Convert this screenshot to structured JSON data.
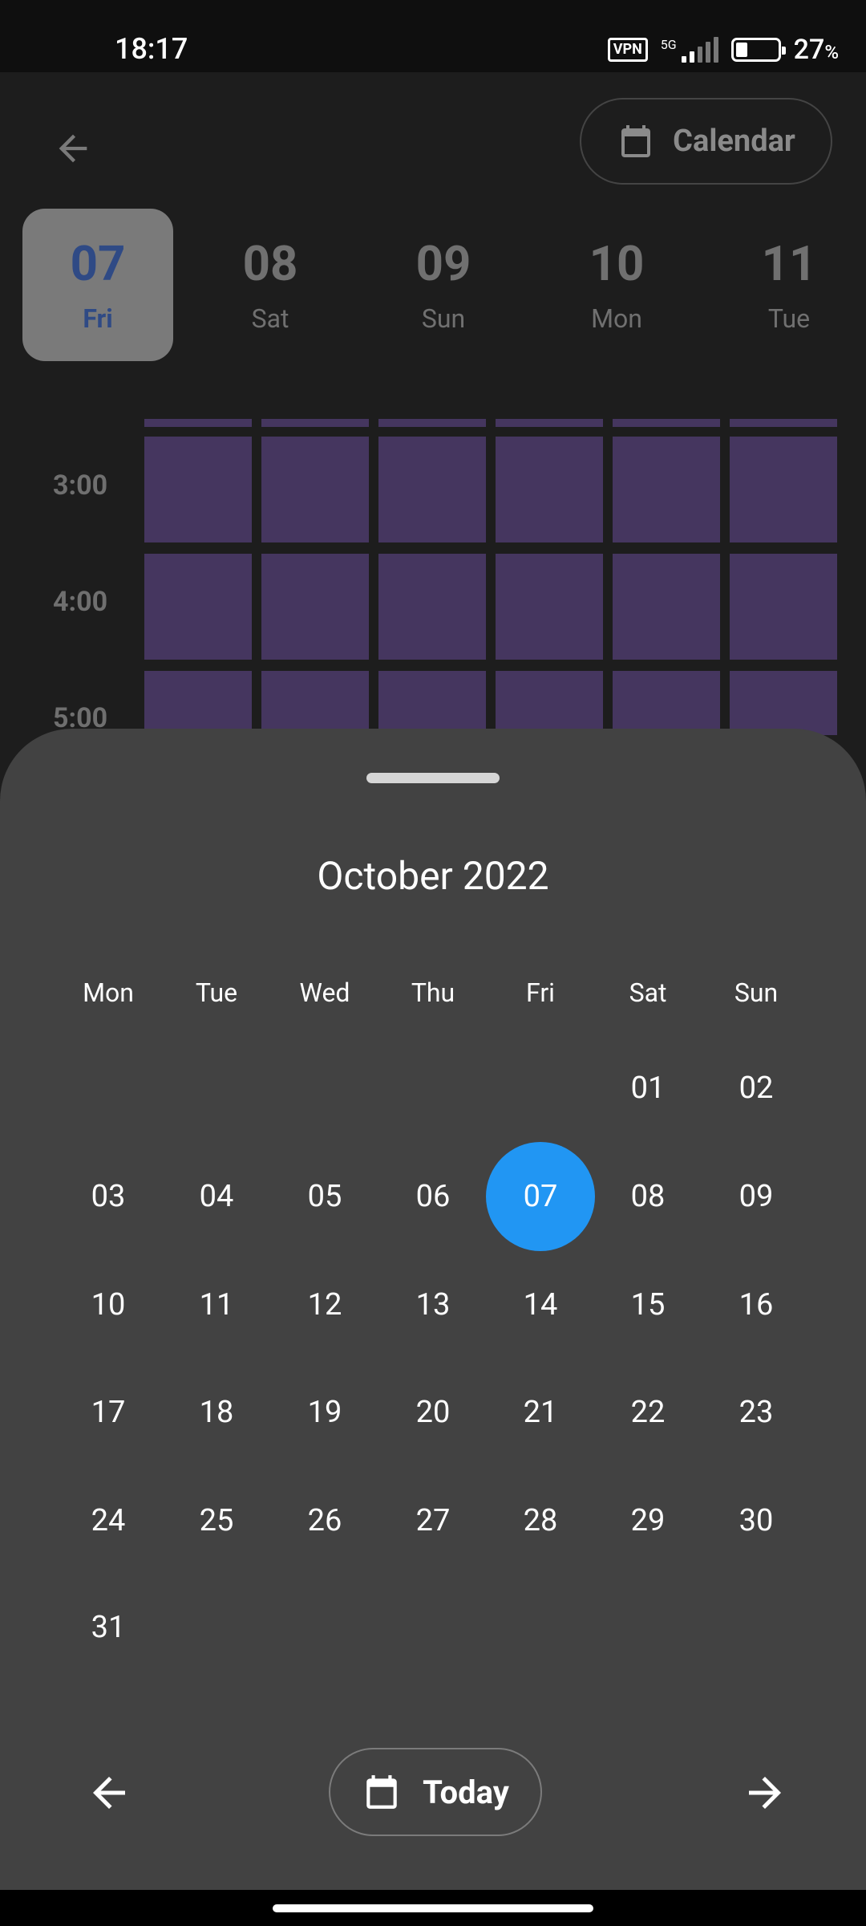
{
  "status_bar": {
    "time": "18:17",
    "vpn": "VPN",
    "network": "5G",
    "battery_percent": "27",
    "battery_unit": "%"
  },
  "toolbar": {
    "back_icon": "arrow-left-icon",
    "calendar_label": "Calendar",
    "calendar_icon": "calendar-icon"
  },
  "day_strip": [
    {
      "num": "07",
      "weekday": "Fri",
      "selected": true
    },
    {
      "num": "08",
      "weekday": "Sat",
      "selected": false
    },
    {
      "num": "09",
      "weekday": "Sun",
      "selected": false
    },
    {
      "num": "10",
      "weekday": "Mon",
      "selected": false
    },
    {
      "num": "11",
      "weekday": "Tue",
      "selected": false
    }
  ],
  "hours": [
    "3:00",
    "4:00",
    "5:00"
  ],
  "colors": {
    "slot": "#45365f",
    "selected_date": "#2196f3",
    "sheet_bg": "#424242",
    "app_bg": "#1d1d1d"
  },
  "picker": {
    "month_title": "October 2022",
    "weekdays": [
      "Mon",
      "Tue",
      "Wed",
      "Thu",
      "Fri",
      "Sat",
      "Sun"
    ],
    "weeks": [
      [
        "",
        "",
        "",
        "",
        "",
        "01",
        "02"
      ],
      [
        "03",
        "04",
        "05",
        "06",
        "07",
        "08",
        "09"
      ],
      [
        "10",
        "11",
        "12",
        "13",
        "14",
        "15",
        "16"
      ],
      [
        "17",
        "18",
        "19",
        "20",
        "21",
        "22",
        "23"
      ],
      [
        "24",
        "25",
        "26",
        "27",
        "28",
        "29",
        "30"
      ],
      [
        "31",
        "",
        "",
        "",
        "",
        "",
        ""
      ]
    ],
    "selected_date": "07",
    "today_label": "Today",
    "prev_icon": "arrow-left-icon",
    "next_icon": "arrow-right-icon"
  }
}
